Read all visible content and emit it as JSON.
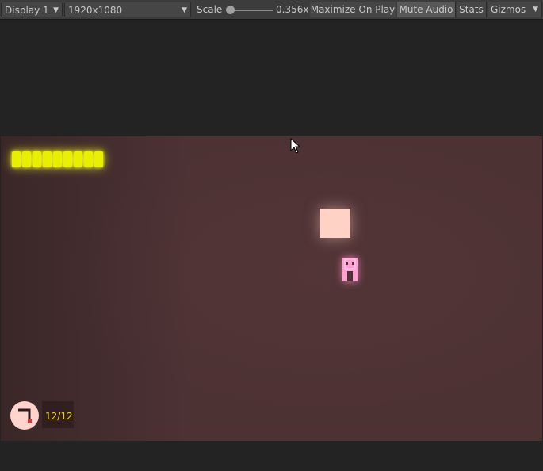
{
  "toolbar": {
    "display_label": "Display 1",
    "resolution_label": "1920x1080",
    "scale_label": "Scale",
    "scale_value": "0.356x",
    "maximize_label": "Maximize On Play",
    "mute_label": "Mute Audio",
    "stats_label": "Stats",
    "gizmos_label": "Gizmos",
    "scale_slider_fraction": 0.02
  },
  "hud": {
    "health_segments": 9,
    "ammo": "12/12"
  },
  "colors": {
    "background": "#4d3234",
    "health": "#e8f000",
    "ammo_text": "#f5d600",
    "block": "#ffd2c6",
    "player": "#ff9fd2"
  }
}
